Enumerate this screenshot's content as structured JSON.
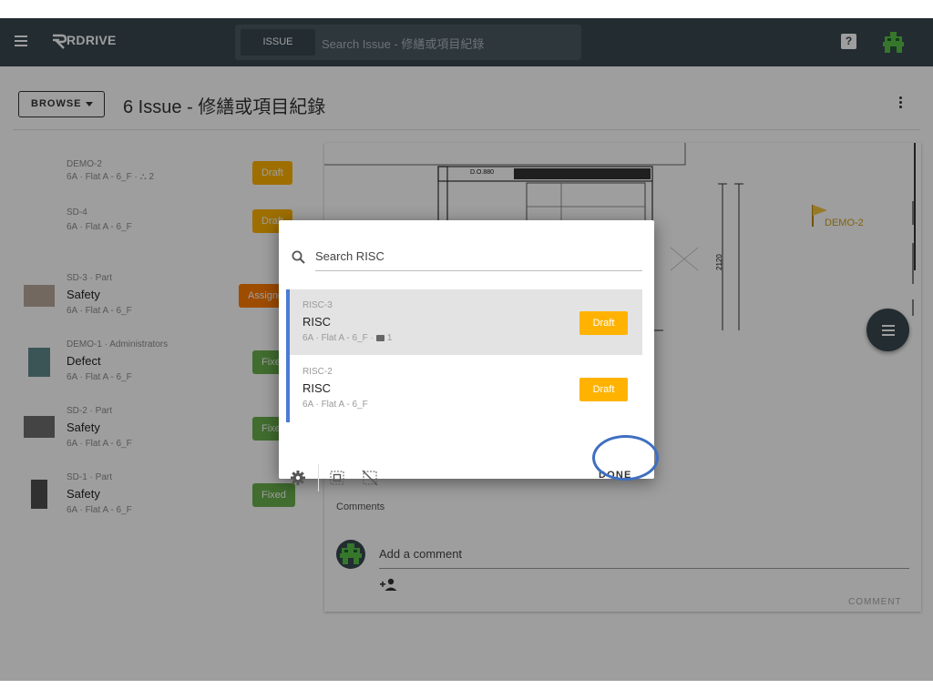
{
  "topbar": {
    "logo_text": "RDRIVE",
    "search_chip": "ISSUE",
    "search_placeholder": "Search Issue - 修繕或項目紀錄",
    "help_glyph": "?"
  },
  "header": {
    "browse_label": "BROWSE",
    "title": "6 Issue - 修繕或項目紀錄"
  },
  "issues": [
    {
      "code": "DEMO-2",
      "name": "",
      "location": "6A · Flat A - 6_F · ⛬ 2",
      "status": "Draft"
    },
    {
      "code": "SD-4",
      "name": "",
      "location": "6A · Flat A - 6_F",
      "status": "Draft"
    },
    {
      "code": "SD-3 · Part",
      "name": "Safety",
      "location": "6A · Flat A - 6_F",
      "status": "Assigned"
    },
    {
      "code": "DEMO-1 · Administrators",
      "name": "Defect",
      "location": "6A · Flat A - 6_F",
      "status": "Fixed"
    },
    {
      "code": "SD-2 · Part",
      "name": "Safety",
      "location": "6A · Flat A - 6_F",
      "status": "Fixed"
    },
    {
      "code": "SD-1 · Part",
      "name": "Safety",
      "location": "6A · Flat A - 6_F",
      "status": "Fixed"
    }
  ],
  "plan": {
    "dim_label": "D.O.880",
    "height_label": "2120",
    "pin_label": "DEMO-2"
  },
  "comments": {
    "label": "Comments",
    "placeholder": "Add a comment",
    "button": "COMMENT"
  },
  "modal": {
    "search_placeholder": "Search RISC",
    "items": [
      {
        "code": "RISC-3",
        "name": "RISC",
        "location": "6A · Flat A - 6_F ·",
        "attachments": "1",
        "status": "Draft"
      },
      {
        "code": "RISC-2",
        "name": "RISC",
        "location": "6A · Flat A - 6_F",
        "status": "Draft"
      }
    ],
    "done_label": "DONE"
  },
  "colors": {
    "topbar": "#37474f",
    "draft": "#ffb300",
    "assigned": "#ff7b00",
    "fixed": "#6ab04c",
    "accent": "#4a7bd4"
  }
}
